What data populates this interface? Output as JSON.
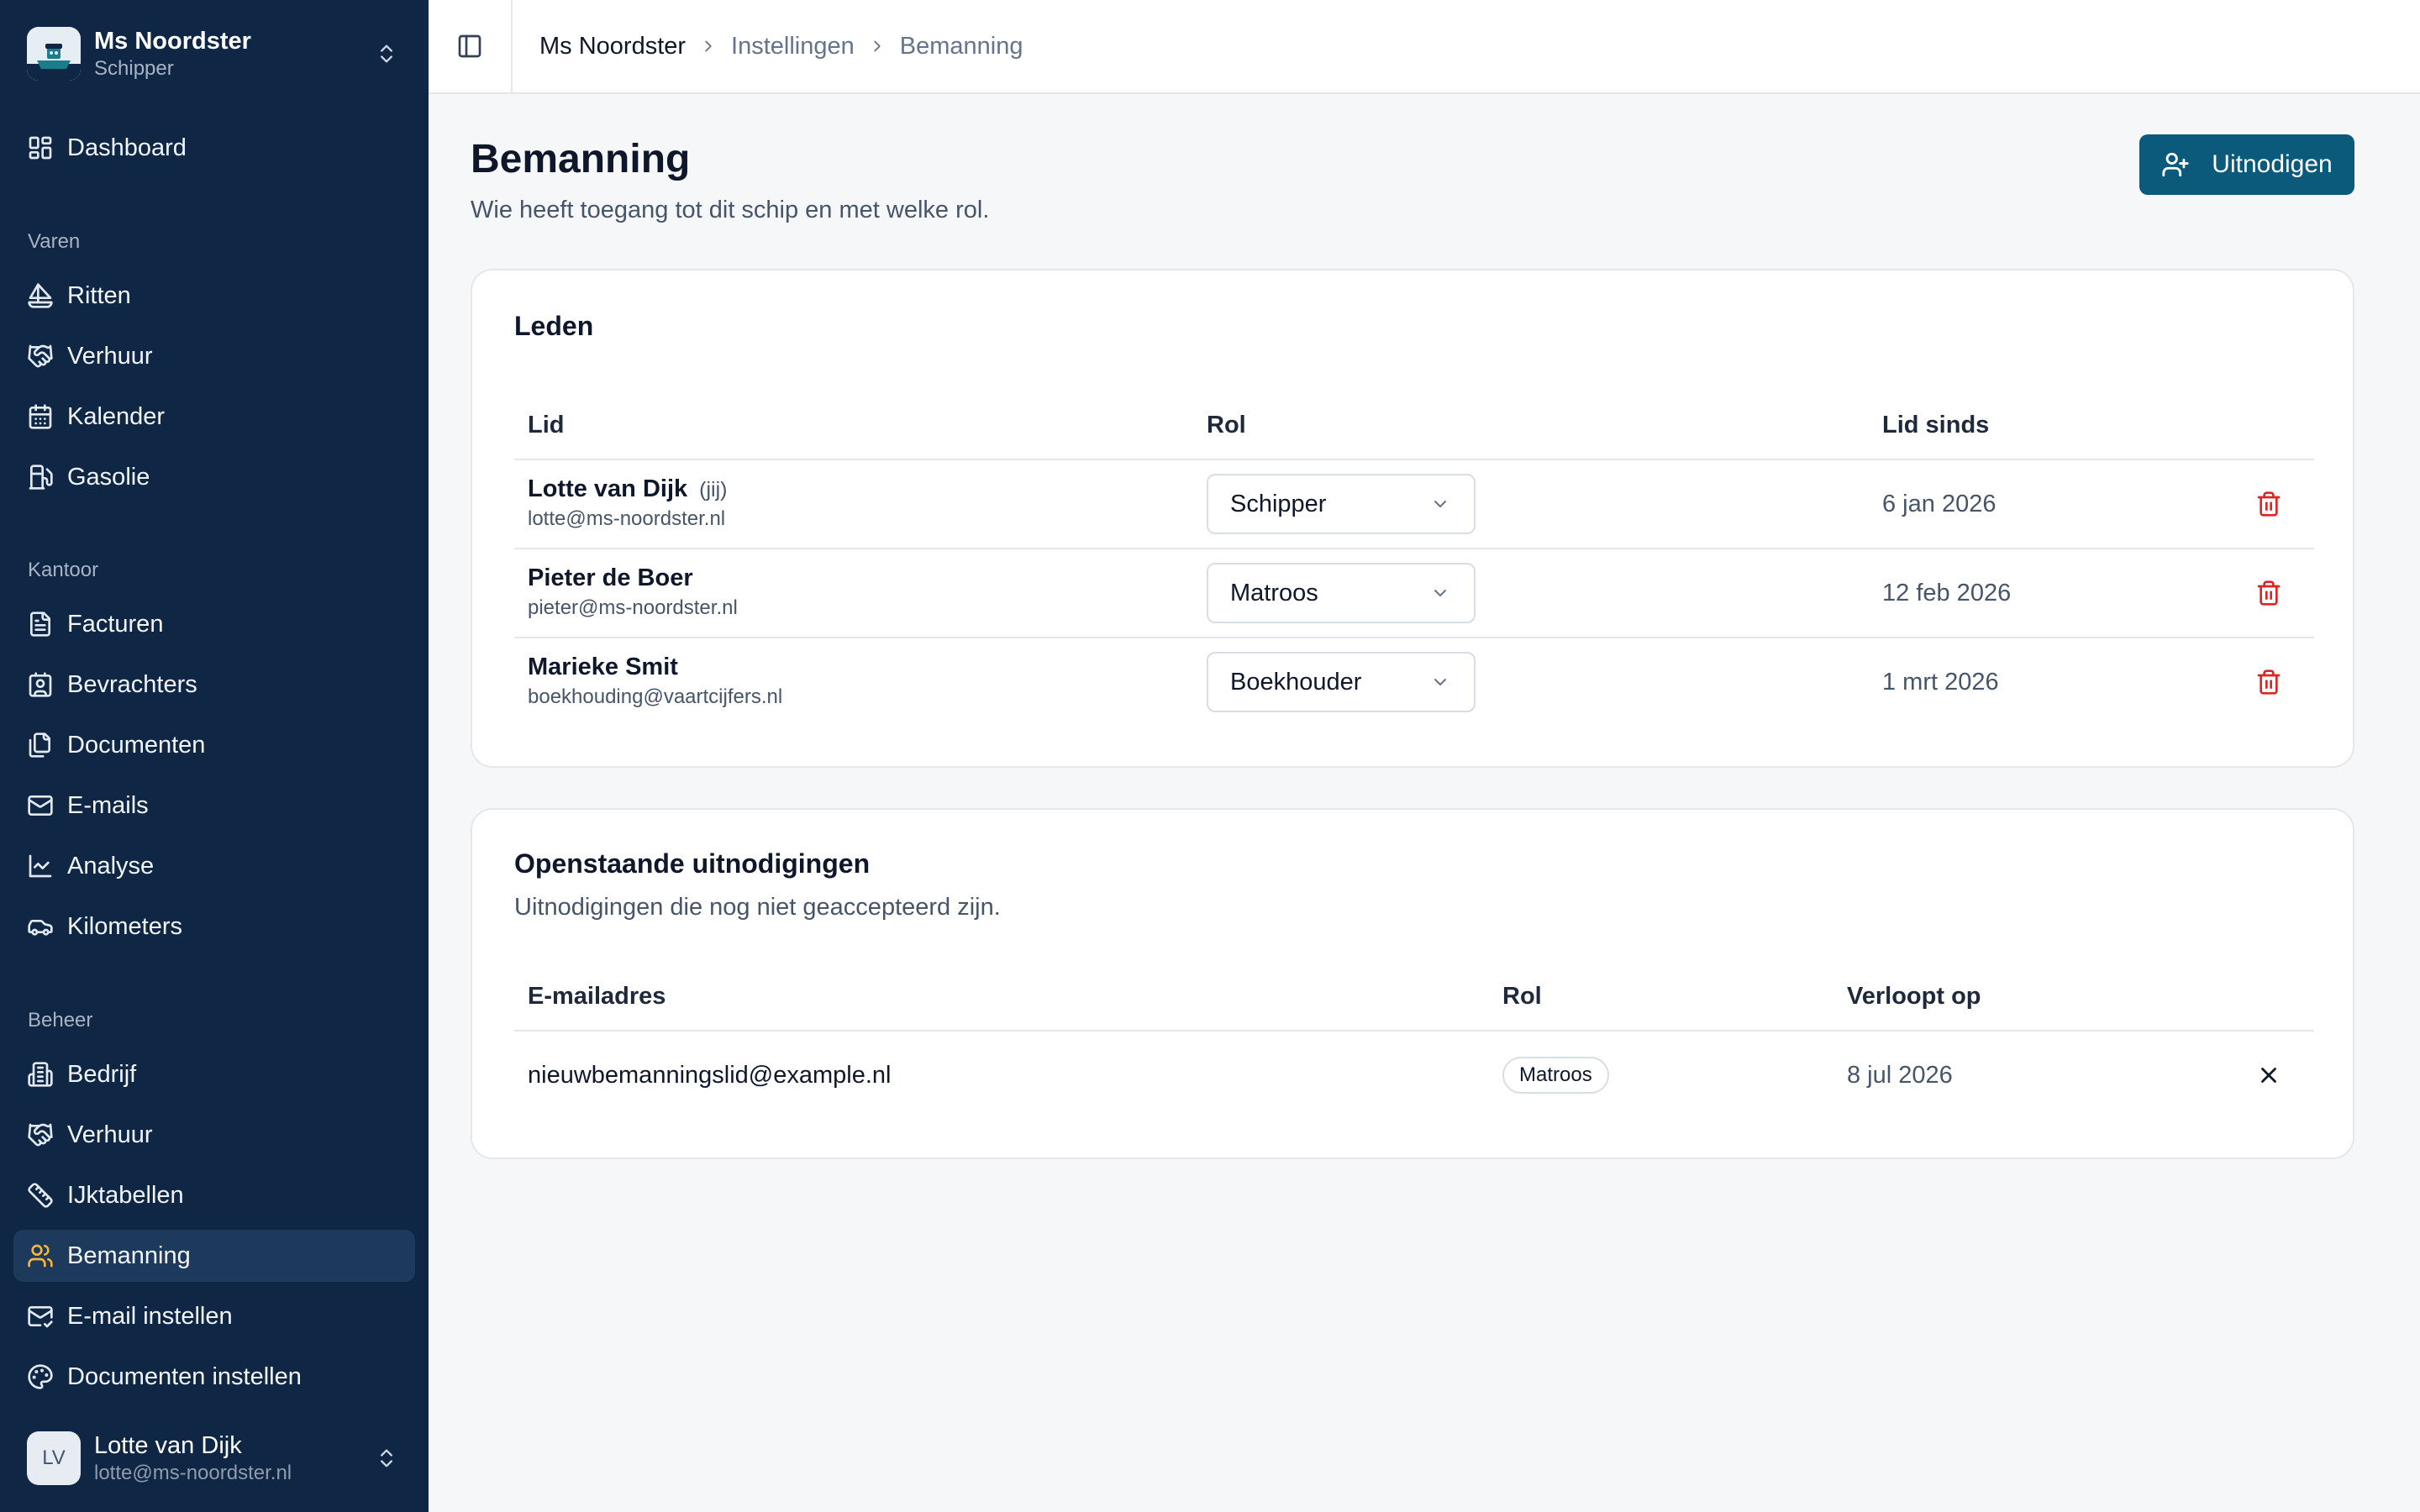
{
  "ship": {
    "name": "Ms Noordster",
    "role": "Schipper",
    "logo_icon": "ship-logo-icon"
  },
  "nav": {
    "dashboard": "Dashboard",
    "section_varen": "Varen",
    "varen": [
      "Ritten",
      "Verhuur",
      "Kalender",
      "Gasolie"
    ],
    "section_kantoor": "Kantoor",
    "kantoor": [
      "Facturen",
      "Bevrachters",
      "Documenten",
      "E-mails",
      "Analyse",
      "Kilometers"
    ],
    "section_beheer": "Beheer",
    "beheer": [
      "Bedrijf",
      "Verhuur",
      "IJktabellen",
      "Bemanning",
      "E-mail instellen",
      "Documenten instellen"
    ],
    "active": "Bemanning",
    "accent_color": "#f5b63c"
  },
  "user": {
    "initials": "LV",
    "name": "Lotte van Dijk",
    "email": "lotte@ms-noordster.nl"
  },
  "breadcrumb": [
    "Ms Noordster",
    "Instellingen",
    "Bemanning"
  ],
  "page": {
    "title": "Bemanning",
    "subtitle": "Wie heeft toegang tot dit schip en met welke rol.",
    "invite_button": "Uitnodigen",
    "primary_color": "#0b5a7c"
  },
  "members": {
    "title": "Leden",
    "columns": [
      "Lid",
      "Rol",
      "Lid sinds"
    ],
    "rows": [
      {
        "name": "Lotte van Dijk",
        "tag": "(jij)",
        "email": "lotte@ms-noordster.nl",
        "role": "Schipper",
        "since": "6 jan 2026"
      },
      {
        "name": "Pieter de Boer",
        "tag": "",
        "email": "pieter@ms-noordster.nl",
        "role": "Matroos",
        "since": "12 feb 2026"
      },
      {
        "name": "Marieke Smit",
        "tag": "",
        "email": "boekhouding@vaartcijfers.nl",
        "role": "Boekhouder",
        "since": "1 mrt 2026"
      }
    ]
  },
  "invitations": {
    "title": "Openstaande uitnodigingen",
    "subtitle": "Uitnodigingen die nog niet geaccepteerd zijn.",
    "columns": [
      "E-mailadres",
      "Rol",
      "Verloopt op"
    ],
    "rows": [
      {
        "email": "nieuwbemanningslid@example.nl",
        "role": "Matroos",
        "expires": "8 jul 2026"
      }
    ]
  }
}
